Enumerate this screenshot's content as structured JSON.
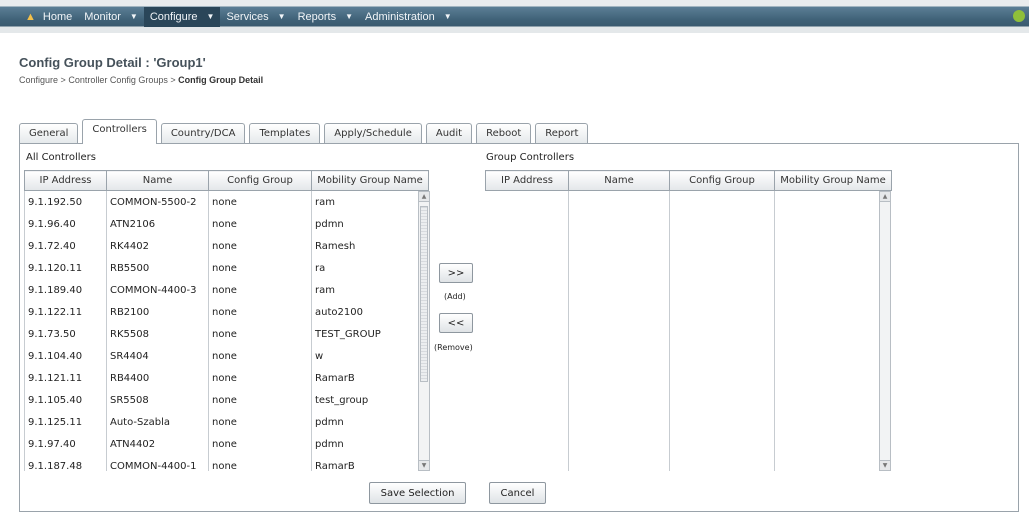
{
  "nav": {
    "items": [
      {
        "label": "Home"
      },
      {
        "label": "Monitor"
      },
      {
        "label": "Configure"
      },
      {
        "label": "Services"
      },
      {
        "label": "Reports"
      },
      {
        "label": "Administration"
      }
    ]
  },
  "page": {
    "title": "Config Group Detail : 'Group1'",
    "breadcrumb": {
      "part1": "Configure",
      "sep": ">",
      "part2": "Controller Config Groups",
      "current": "Config Group Detail"
    }
  },
  "tabs": [
    {
      "label": "General"
    },
    {
      "label": "Controllers"
    },
    {
      "label": "Country/DCA"
    },
    {
      "label": "Templates"
    },
    {
      "label": "Apply/Schedule"
    },
    {
      "label": "Audit"
    },
    {
      "label": "Reboot"
    },
    {
      "label": "Report"
    }
  ],
  "all_controllers": {
    "label": "All Controllers",
    "columns": [
      "IP Address",
      "Name",
      "Config Group",
      "Mobility Group Name"
    ],
    "rows": [
      [
        "9.1.192.50",
        "COMMON-5500-2",
        "none",
        "ram"
      ],
      [
        "9.1.96.40",
        "ATN2106",
        "none",
        "pdmn"
      ],
      [
        "9.1.72.40",
        "RK4402",
        "none",
        "Ramesh"
      ],
      [
        "9.1.120.11",
        "RB5500",
        "none",
        "ra"
      ],
      [
        "9.1.189.40",
        "COMMON-4400-3",
        "none",
        "ram"
      ],
      [
        "9.1.122.11",
        "RB2100",
        "none",
        "auto2100"
      ],
      [
        "9.1.73.50",
        "RK5508",
        "none",
        "TEST_GROUP"
      ],
      [
        "9.1.104.40",
        "SR4404",
        "none",
        "w"
      ],
      [
        "9.1.121.11",
        "RB4400",
        "none",
        "RamarB"
      ],
      [
        "9.1.105.40",
        "SR5508",
        "none",
        "test_group"
      ],
      [
        "9.1.125.11",
        "Auto-Szabla",
        "none",
        "pdmn"
      ],
      [
        "9.1.97.40",
        "ATN4402",
        "none",
        "pdmn"
      ],
      [
        "9.1.187.48",
        "COMMON-4400-1",
        "none",
        "RamarB"
      ]
    ]
  },
  "group_controllers": {
    "label": "Group Controllers",
    "columns": [
      "IP Address",
      "Name",
      "Config Group",
      "Mobility Group Name"
    ]
  },
  "transfer": {
    "add_button": ">>",
    "add_caption": "(Add)",
    "remove_button": "<<",
    "remove_caption": "(Remove)"
  },
  "footer": {
    "save": "Save Selection",
    "cancel": "Cancel"
  },
  "colors": {
    "nav_bg": "#3f6177",
    "nav_active": "#2a4659",
    "title": "#45515a",
    "border": "#9aa3ab"
  }
}
